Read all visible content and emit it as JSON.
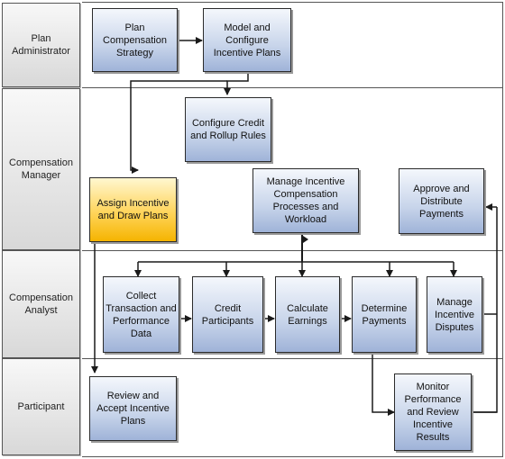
{
  "diagram": {
    "lanes": [
      {
        "id": "plan-administrator",
        "label": "Plan Administrator"
      },
      {
        "id": "compensation-manager",
        "label": "Compensation Manager"
      },
      {
        "id": "compensation-analyst",
        "label": "Compensation Analyst"
      },
      {
        "id": "participant",
        "label": "Participant"
      }
    ],
    "nodes": {
      "plan_strategy": {
        "label": "Plan Compensation Strategy",
        "lane": "plan-administrator"
      },
      "model_configure": {
        "label": "Model and Configure Incentive Plans",
        "lane": "plan-administrator"
      },
      "configure_credit": {
        "label": "Configure Credit and Rollup Rules",
        "lane": "compensation-manager"
      },
      "assign_plans": {
        "label": "Assign Incentive and Draw Plans",
        "lane": "compensation-manager",
        "highlighted": true
      },
      "manage_processes": {
        "label": "Manage Incentive Compensation Processes and Workload",
        "lane": "compensation-manager"
      },
      "approve_distribute": {
        "label": "Approve and Distribute Payments",
        "lane": "compensation-manager"
      },
      "collect_data": {
        "label": "Collect Transaction and Performance Data",
        "lane": "compensation-analyst"
      },
      "credit_participants": {
        "label": "Credit Participants",
        "lane": "compensation-analyst"
      },
      "calculate_earnings": {
        "label": "Calculate Earnings",
        "lane": "compensation-analyst"
      },
      "determine_payments": {
        "label": "Determine Payments",
        "lane": "compensation-analyst"
      },
      "manage_disputes": {
        "label": "Manage Incentive Disputes",
        "lane": "compensation-analyst"
      },
      "review_accept": {
        "label": "Review and Accept Incentive Plans",
        "lane": "participant"
      },
      "monitor_performance": {
        "label": "Monitor Performance and Review Incentive Results",
        "lane": "participant"
      }
    },
    "edges": [
      {
        "from": "plan_strategy",
        "to": "model_configure"
      },
      {
        "from": "model_configure",
        "to": "configure_credit"
      },
      {
        "from": "model_configure",
        "to": "assign_plans"
      },
      {
        "from": "assign_plans",
        "to": "review_accept"
      },
      {
        "from": "manage_processes",
        "to": "collect_data"
      },
      {
        "from": "manage_processes",
        "to": "credit_participants"
      },
      {
        "from": "manage_processes",
        "to": "calculate_earnings"
      },
      {
        "from": "manage_processes",
        "to": "determine_payments"
      },
      {
        "from": "manage_processes",
        "to": "manage_disputes"
      },
      {
        "from": "collect_data",
        "to": "credit_participants"
      },
      {
        "from": "credit_participants",
        "to": "calculate_earnings"
      },
      {
        "from": "calculate_earnings",
        "to": "determine_payments"
      },
      {
        "from": "determine_payments",
        "to": "monitor_performance"
      },
      {
        "from": "monitor_performance",
        "to": "manage_disputes"
      },
      {
        "from": "monitor_performance",
        "to": "approve_distribute"
      }
    ],
    "colors": {
      "node_fill_top": "#f4f7fc",
      "node_fill_bottom": "#9fb3d8",
      "highlight_fill_top": "#fff7d0",
      "highlight_fill_bottom": "#f5b400",
      "line": "#1a1a1a"
    }
  }
}
